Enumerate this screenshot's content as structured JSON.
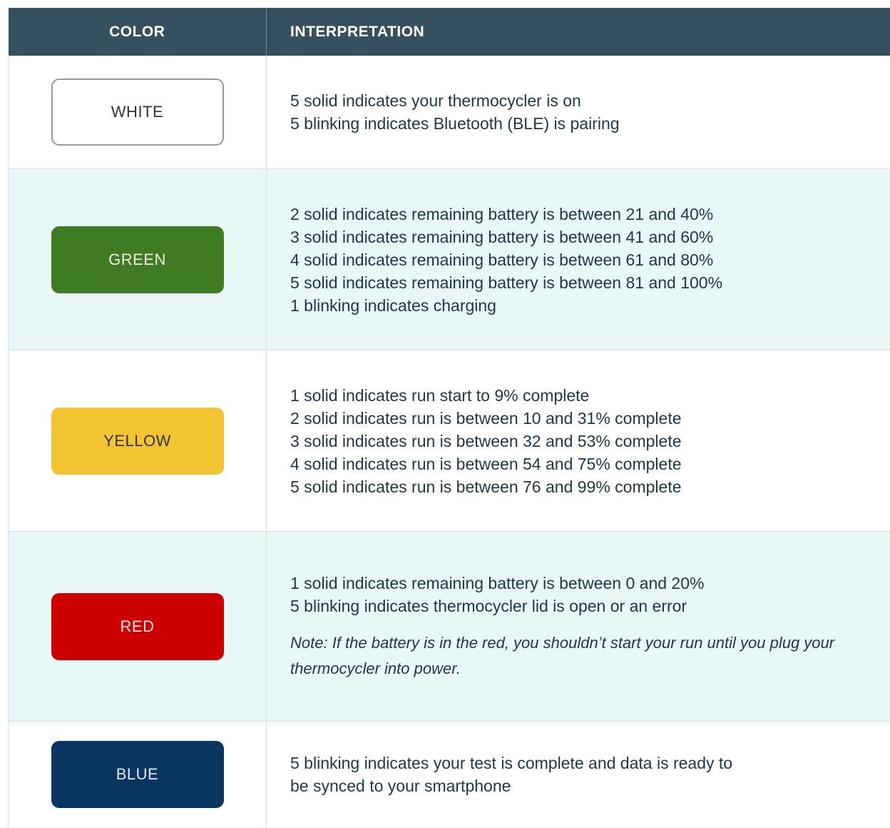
{
  "header": {
    "color": "COLOR",
    "interpretation": "INTERPRETATION"
  },
  "rows": [
    {
      "swatch_label": "WHITE",
      "swatch_color": "#ffffff",
      "lines": [
        "5 solid indicates your thermocycler is on",
        "5 blinking indicates Bluetooth (BLE) is pairing"
      ]
    },
    {
      "swatch_label": "GREEN",
      "swatch_color": "#3e7b22",
      "lines": [
        "2 solid indicates remaining battery is between 21 and 40%",
        "3 solid indicates remaining battery is between 41 and 60%",
        "4 solid indicates remaining battery is between 61 and 80%",
        "5 solid indicates remaining battery is between 81 and 100%",
        "1 blinking indicates charging"
      ]
    },
    {
      "swatch_label": "YELLOW",
      "swatch_color": "#f2c432",
      "lines": [
        "1 solid indicates run start to 9% complete",
        "2 solid indicates run is between 10 and 31% complete",
        "3 solid indicates run is between 32 and 53% complete",
        "4 solid indicates run is between 54 and 75% complete",
        "5 solid indicates run is between 76 and 99% complete"
      ]
    },
    {
      "swatch_label": "RED",
      "swatch_color": "#cc0000",
      "lines": [
        "1 solid indicates remaining battery is between 0 and 20%",
        "5 blinking indicates thermocycler lid is open or an error"
      ],
      "note_label": "Note:",
      "note_line1": " If the battery is in the red, you shouldn’t start your run until you plug your",
      "note_line2": "thermocycler into power."
    },
    {
      "swatch_label": "BLUE",
      "swatch_color": "#0a3560",
      "lines": [
        "5 blinking indicates your test is complete and data is ready to",
        "be synced to your smartphone"
      ]
    }
  ],
  "colors": {
    "header_bg": "#35505f",
    "shaded_row_bg": "#e9f7f7",
    "body_text": "#1f3848"
  }
}
